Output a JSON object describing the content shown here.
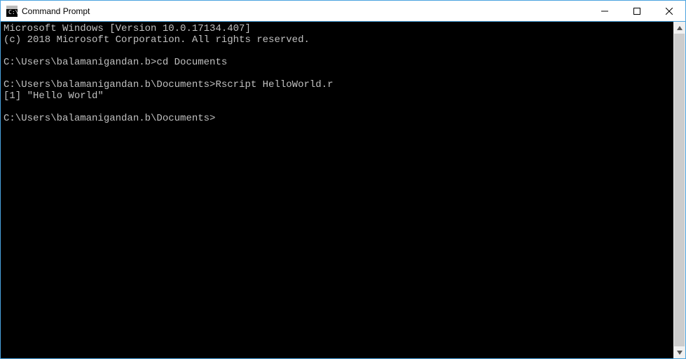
{
  "window": {
    "title": "Command Prompt"
  },
  "terminal": {
    "lines": [
      "Microsoft Windows [Version 10.0.17134.407]",
      "(c) 2018 Microsoft Corporation. All rights reserved.",
      "",
      "C:\\Users\\balamanigandan.b>cd Documents",
      "",
      "C:\\Users\\balamanigandan.b\\Documents>Rscript HelloWorld.r",
      "[1] \"Hello World\"",
      "",
      "C:\\Users\\balamanigandan.b\\Documents>"
    ]
  }
}
